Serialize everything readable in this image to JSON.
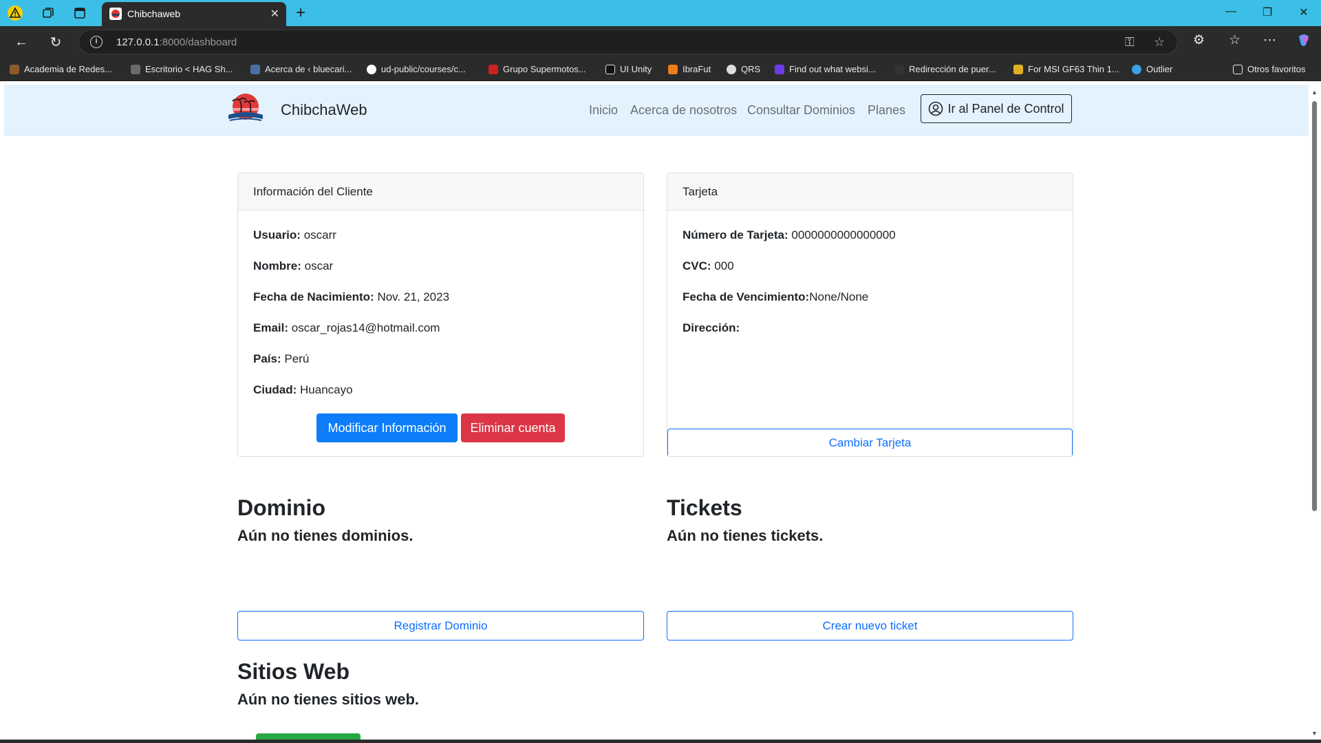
{
  "browser": {
    "tab_title": "Chibchaweb",
    "new_tab_symbol": "+",
    "tab_close_symbol": "✕",
    "url_host": "127.0.0.1",
    "url_rest": ":8000/dashboard",
    "bookmarks": [
      {
        "label": "Academia de Redes...",
        "color": "#8b5a2b"
      },
      {
        "label": "Escritorio < HAG Sh...",
        "color": "#6b6b6b"
      },
      {
        "label": "Acerca de ‹ bluecari...",
        "color": "#4a6fa5"
      },
      {
        "label": "ud-public/courses/c...",
        "color": "#ffffff"
      },
      {
        "label": "Grupo Supermotos...",
        "color": "#cc2222"
      },
      {
        "label": "UI Unity",
        "color": "#111111"
      },
      {
        "label": "IbraFut",
        "color": "#f07c1b"
      },
      {
        "label": "QRS",
        "color": "#dddddd"
      },
      {
        "label": "Find out what websi...",
        "color": "#6a3de8"
      },
      {
        "label": "Redirección de puer...",
        "color": "#333333"
      },
      {
        "label": "For MSI GF63 Thin 1...",
        "color": "#e0b020"
      },
      {
        "label": "Outlier",
        "color": "#3ca0e6"
      }
    ],
    "other_favorites": "Otros favoritos"
  },
  "site": {
    "brand": "ChibchaWeb",
    "nav": [
      "Inicio",
      "Acerca de nosotros",
      "Consultar Dominios",
      "Planes"
    ],
    "panel_button": "Ir al Panel de Control"
  },
  "client_card": {
    "header": "Información del Cliente",
    "fields": [
      {
        "label": "Usuario:",
        "value": " oscarr"
      },
      {
        "label": "Nombre:",
        "value": " oscar"
      },
      {
        "label": "Fecha de Nacimiento:",
        "value": " Nov. 21, 2023"
      },
      {
        "label": "Email:",
        "value": " oscar_rojas14@hotmail.com"
      },
      {
        "label": "País:",
        "value": " Perú"
      },
      {
        "label": "Ciudad:",
        "value": " Huancayo"
      }
    ],
    "modify_button": "Modificar Información",
    "delete_button": "Eliminar cuenta"
  },
  "card_card": {
    "header": "Tarjeta",
    "fields": [
      {
        "label": "Número de Tarjeta:",
        "value": " 0000000000000000"
      },
      {
        "label": "CVC:",
        "value": " 000"
      },
      {
        "label": "Fecha de Vencimiento:",
        "value": "None/None"
      },
      {
        "label": "Dirección:",
        "value": ""
      }
    ],
    "change_button": "Cambiar Tarjeta"
  },
  "domains": {
    "title": "Dominio",
    "empty": "Aún no tienes dominios.",
    "button": "Registrar Dominio"
  },
  "tickets": {
    "title": "Tickets",
    "empty": "Aún no tienes tickets.",
    "button": "Crear nuevo ticket"
  },
  "websites": {
    "title": "Sitios Web",
    "empty": "Aún no tienes sitios web."
  },
  "colors": {
    "primary": "#0d7df9",
    "danger": "#dc3545",
    "outline": "#0d6efd",
    "success": "#28a745",
    "nav_bg": "#e3f2fd",
    "tabbar_bg": "#3bbfe6"
  }
}
